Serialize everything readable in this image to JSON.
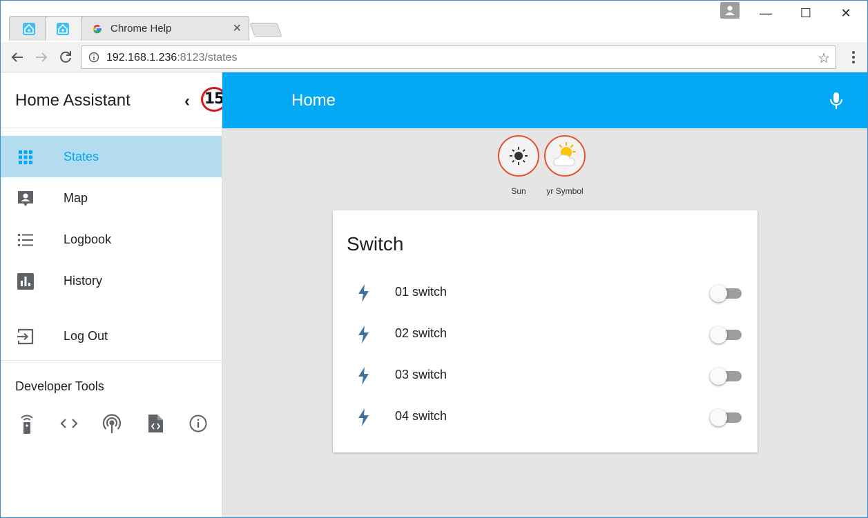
{
  "browser": {
    "tabs": [
      {
        "title": "",
        "icon": "home-assistant-favicon",
        "active": false
      },
      {
        "title": "",
        "icon": "home-assistant-favicon",
        "active": true
      },
      {
        "title": "Chrome Help",
        "icon": "google-g-icon",
        "active": false
      }
    ],
    "tab_close_glyph": "✕",
    "url_host": "192.168.1.236",
    "url_rest": ":8123/states",
    "window_controls": [
      "—",
      "☐",
      "✕"
    ]
  },
  "sidebar": {
    "title": "Home Assistant",
    "collapse_glyph": "‹",
    "annotation_badge": "15",
    "items": [
      {
        "label": "States",
        "icon": "grid-icon",
        "selected": true
      },
      {
        "label": "Map",
        "icon": "account-box-icon"
      },
      {
        "label": "Logbook",
        "icon": "list-icon"
      },
      {
        "label": "History",
        "icon": "chart-box-icon"
      },
      {
        "label": "Log Out",
        "icon": "exit-icon"
      }
    ],
    "developer_tools_title": "Developer Tools",
    "developer_tools": [
      "remote-icon",
      "code-icon",
      "broadcast-icon",
      "file-code-icon",
      "info-icon"
    ]
  },
  "header": {
    "title": "Home",
    "mic_icon": "microphone-icon"
  },
  "badges": [
    {
      "label": "Sun",
      "icon": "sun-icon"
    },
    {
      "label": "yr Symbol",
      "icon": "partly-cloudy-icon"
    }
  ],
  "card": {
    "title": "Switch",
    "rows": [
      {
        "name": "01 switch",
        "state": "off"
      },
      {
        "name": "02 switch",
        "state": "off"
      },
      {
        "name": "03 switch",
        "state": "off"
      },
      {
        "name": "04 switch",
        "state": "off"
      }
    ]
  },
  "colors": {
    "accent": "#03a9f4",
    "selected_bg": "#b3dcf0",
    "badge_border": "#e3542d",
    "bolt": "#44739e"
  }
}
